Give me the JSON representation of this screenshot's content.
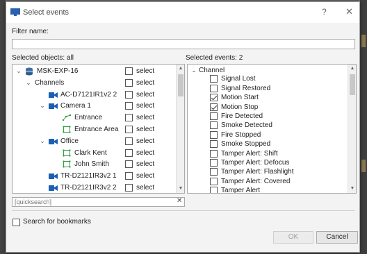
{
  "window": {
    "title": "Select events",
    "help_label": "?",
    "close_label": "✕"
  },
  "filter": {
    "label": "Filter name:",
    "value": ""
  },
  "objects": {
    "label": "Selected objects: all",
    "tree": [
      {
        "label": "MSK-EXP-16",
        "select": "select",
        "icon": "server-icon",
        "arrow": "⌄"
      },
      {
        "label": "Channels",
        "select": "select",
        "icon": "",
        "arrow": "⌄"
      },
      {
        "label": "AC-D7121IR1v2 2",
        "select": "select",
        "icon": "camera-icon",
        "arrow": ""
      },
      {
        "label": "Camera 1",
        "select": "select",
        "icon": "camera-icon",
        "arrow": "⌄"
      },
      {
        "label": "Entrance",
        "select": "select",
        "icon": "line-zone-icon",
        "arrow": ""
      },
      {
        "label": "Entrance Area",
        "select": "select",
        "icon": "area-zone-icon",
        "arrow": ""
      },
      {
        "label": "Office",
        "select": "select",
        "icon": "camera-icon",
        "arrow": "⌄"
      },
      {
        "label": "Clark Kent",
        "select": "select",
        "icon": "area-zone-icon",
        "arrow": ""
      },
      {
        "label": "John Smith",
        "select": "select",
        "icon": "area-zone-icon",
        "arrow": ""
      },
      {
        "label": "TR-D2121IR3v2 1",
        "select": "select",
        "icon": "camera-icon",
        "arrow": ""
      },
      {
        "label": "TR-D2121IR3v2 2",
        "select": "select",
        "icon": "camera-icon",
        "arrow": ""
      }
    ]
  },
  "events": {
    "label": "Selected events: 2",
    "group": "Channel",
    "items": [
      {
        "label": "Signal Lost",
        "checked": false
      },
      {
        "label": "Signal Restored",
        "checked": false
      },
      {
        "label": "Motion Start",
        "checked": true
      },
      {
        "label": "Motion Stop",
        "checked": true
      },
      {
        "label": "Fire Detected",
        "checked": false
      },
      {
        "label": "Smoke Detected",
        "checked": false
      },
      {
        "label": "Fire Stopped",
        "checked": false
      },
      {
        "label": "Smoke Stopped",
        "checked": false
      },
      {
        "label": "Tamper Alert: Shift",
        "checked": false
      },
      {
        "label": "Tamper Alert: Defocus",
        "checked": false
      },
      {
        "label": "Tamper Alert: Flashlight",
        "checked": false
      },
      {
        "label": "Tamper Alert: Covered",
        "checked": false
      },
      {
        "label": "Tamper Alert",
        "checked": false
      }
    ]
  },
  "quicksearch": {
    "placeholder": "[quicksearch]",
    "clear_label": "✕"
  },
  "bookmarks": {
    "label": "Search for bookmarks",
    "checked": false
  },
  "buttons": {
    "ok": "OK",
    "cancel": "Cancel"
  },
  "colors": {
    "icon_blue": "#1a5fb4",
    "zone_green": "#2e9e3e",
    "server_blue": "#3a6ea5"
  }
}
